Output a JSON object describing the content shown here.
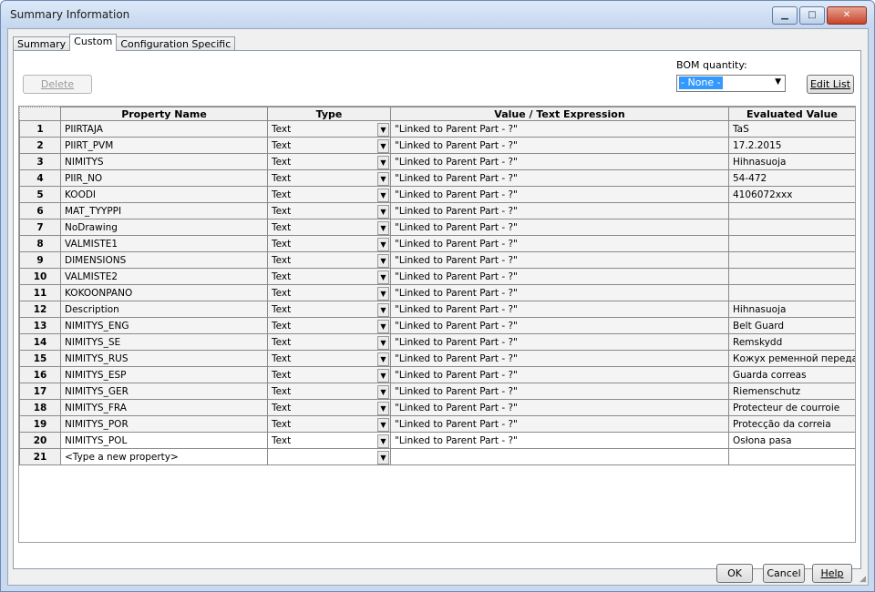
{
  "window": {
    "title": "Summary Information"
  },
  "tabs": [
    "Summary",
    "Custom",
    "Configuration Specific"
  ],
  "toolbar": {
    "delete_label": "Delete",
    "bom_label": "BOM quantity:",
    "bom_value": "- None -",
    "edit_list_label": "Edit List"
  },
  "grid": {
    "headers": [
      "Property Name",
      "Type",
      "Value / Text Expression",
      "Evaluated Value"
    ],
    "rows": [
      {
        "n": "1",
        "name": "PIIRTAJA",
        "type": "Text",
        "value": "\"Linked to Parent Part - ?\"",
        "evaluated": "TaS"
      },
      {
        "n": "2",
        "name": "PIIRT_PVM",
        "type": "Text",
        "value": "\"Linked to Parent Part - ?\"",
        "evaluated": "17.2.2015"
      },
      {
        "n": "3",
        "name": "NIMITYS",
        "type": "Text",
        "value": "\"Linked to Parent Part - ?\"",
        "evaluated": "Hihnasuoja"
      },
      {
        "n": "4",
        "name": "PIIR_NO",
        "type": "Text",
        "value": "\"Linked to Parent Part - ?\"",
        "evaluated": "54-472"
      },
      {
        "n": "5",
        "name": "KOODI",
        "type": "Text",
        "value": "\"Linked to Parent Part - ?\"",
        "evaluated": "4106072xxx"
      },
      {
        "n": "6",
        "name": "MAT_TYYPPI",
        "type": "Text",
        "value": "\"Linked to Parent Part - ?\"",
        "evaluated": ""
      },
      {
        "n": "7",
        "name": "NoDrawing",
        "type": "Text",
        "value": "\"Linked to Parent Part - ?\"",
        "evaluated": ""
      },
      {
        "n": "8",
        "name": "VALMISTE1",
        "type": "Text",
        "value": "\"Linked to Parent Part - ?\"",
        "evaluated": ""
      },
      {
        "n": "9",
        "name": "DIMENSIONS",
        "type": "Text",
        "value": "\"Linked to Parent Part - ?\"",
        "evaluated": ""
      },
      {
        "n": "10",
        "name": "VALMISTE2",
        "type": "Text",
        "value": "\"Linked to Parent Part - ?\"",
        "evaluated": ""
      },
      {
        "n": "11",
        "name": "KOKOONPANO",
        "type": "Text",
        "value": "\"Linked to Parent Part - ?\"",
        "evaluated": ""
      },
      {
        "n": "12",
        "name": "Description",
        "type": "Text",
        "value": "\"Linked to Parent Part - ?\"",
        "evaluated": "Hihnasuoja"
      },
      {
        "n": "13",
        "name": "NIMITYS_ENG",
        "type": "Text",
        "value": "\"Linked to Parent Part - ?\"",
        "evaluated": "Belt Guard"
      },
      {
        "n": "14",
        "name": "NIMITYS_SE",
        "type": "Text",
        "value": "\"Linked to Parent Part - ?\"",
        "evaluated": "Remskydd"
      },
      {
        "n": "15",
        "name": "NIMITYS_RUS",
        "type": "Text",
        "value": "\"Linked to Parent Part - ?\"",
        "evaluated": "Кожух ременной передач"
      },
      {
        "n": "16",
        "name": "NIMITYS_ESP",
        "type": "Text",
        "value": "\"Linked to Parent Part - ?\"",
        "evaluated": "Guarda correas"
      },
      {
        "n": "17",
        "name": "NIMITYS_GER",
        "type": "Text",
        "value": "\"Linked to Parent Part - ?\"",
        "evaluated": "Riemenschutz"
      },
      {
        "n": "18",
        "name": "NIMITYS_FRA",
        "type": "Text",
        "value": "\"Linked to Parent Part - ?\"",
        "evaluated": "Protecteur de courroie"
      },
      {
        "n": "19",
        "name": "NIMITYS_POR",
        "type": "Text",
        "value": "\"Linked to Parent Part - ?\"",
        "evaluated": "Protecção da correia"
      },
      {
        "n": "20",
        "name": "NIMITYS_POL",
        "type": "Text",
        "value": "\"Linked to Parent Part - ?\"",
        "evaluated": "Osłona pasa"
      },
      {
        "n": "21",
        "name": "<Type a new property>",
        "type": "",
        "value": "",
        "evaluated": ""
      }
    ]
  },
  "footer": {
    "ok_label": "OK",
    "cancel_label": "Cancel",
    "help_label": "Help"
  }
}
